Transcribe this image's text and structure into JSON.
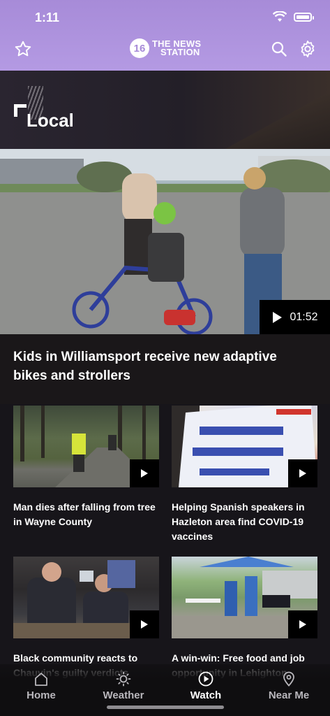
{
  "status_bar": {
    "time": "1:11"
  },
  "header": {
    "logo_number": "16",
    "logo_line1": "THE NEWS",
    "logo_line2": "STATION",
    "icons": [
      "star-icon",
      "search-icon",
      "gear-icon"
    ],
    "background": "#a78bd8"
  },
  "section": {
    "title": "Local"
  },
  "hero": {
    "title": "Kids in Williamsport receive new adaptive bikes and strollers",
    "duration": "01:52"
  },
  "articles": [
    {
      "title": "Man dies after falling from tree in Wayne County"
    },
    {
      "title": "Helping Spanish speakers in Hazleton area find COVID-19 vaccines"
    },
    {
      "title": "Black community reacts to Chauvin's guilty verdicts"
    },
    {
      "title": "A win-win: Free food and job opportunity in Lehighton"
    }
  ],
  "tabs": [
    {
      "label": "Home",
      "icon": "home-icon"
    },
    {
      "label": "Weather",
      "icon": "sun-icon"
    },
    {
      "label": "Watch",
      "icon": "play-circle-icon",
      "active": true
    },
    {
      "label": "Near Me",
      "icon": "location-pin-icon"
    }
  ]
}
